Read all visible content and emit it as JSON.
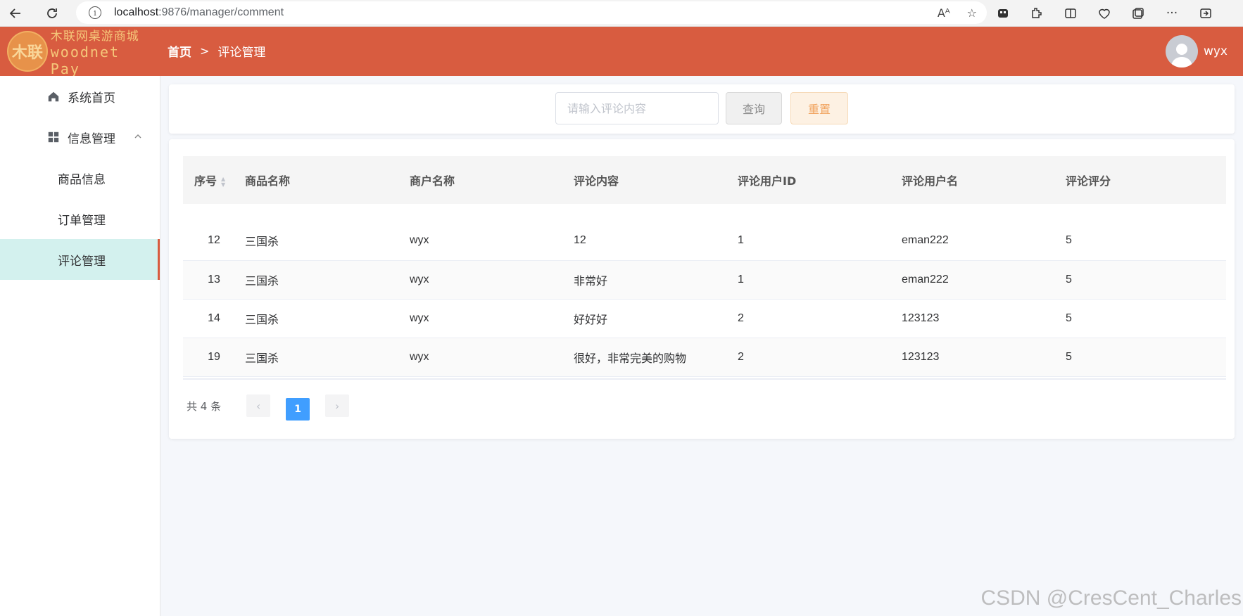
{
  "browser": {
    "url_host": "localhost",
    "url_path": ":9876/manager/comment",
    "read_aloud": "Aᴬ",
    "more": "···"
  },
  "header": {
    "logo_cn": "木联网桌游商城",
    "logo_en": "woodnet Pay",
    "logo_mark": "木联",
    "breadcrumb_home": "首页",
    "breadcrumb_sep": ">",
    "breadcrumb_current": "评论管理",
    "username": "wyx",
    "brand_color": "#d85c40"
  },
  "sidebar": {
    "home_label": "系统首页",
    "info_label": "信息管理",
    "items": [
      {
        "label": "商品信息"
      },
      {
        "label": "订单管理"
      },
      {
        "label": "评论管理"
      }
    ]
  },
  "search": {
    "placeholder": "请输入评论内容",
    "query_label": "查询",
    "reset_label": "重置"
  },
  "table": {
    "columns": [
      "序号",
      "商品名称",
      "商户名称",
      "评论内容",
      "评论用户ID",
      "评论用户名",
      "评论评分"
    ],
    "rows": [
      [
        "12",
        "三国杀",
        "wyx",
        "12",
        "1",
        "eman222",
        "5"
      ],
      [
        "13",
        "三国杀",
        "wyx",
        "非常好",
        "1",
        "eman222",
        "5"
      ],
      [
        "14",
        "三国杀",
        "wyx",
        "好好好",
        "2",
        "123123",
        "5"
      ],
      [
        "19",
        "三国杀",
        "wyx",
        "很好，非常完美的购物",
        "2",
        "123123",
        "5"
      ]
    ]
  },
  "pagination": {
    "total_text": "共 4 条",
    "current_page": "1",
    "prev": "‹",
    "next": "›"
  },
  "watermark": "CSDN @CresCent_Charles"
}
